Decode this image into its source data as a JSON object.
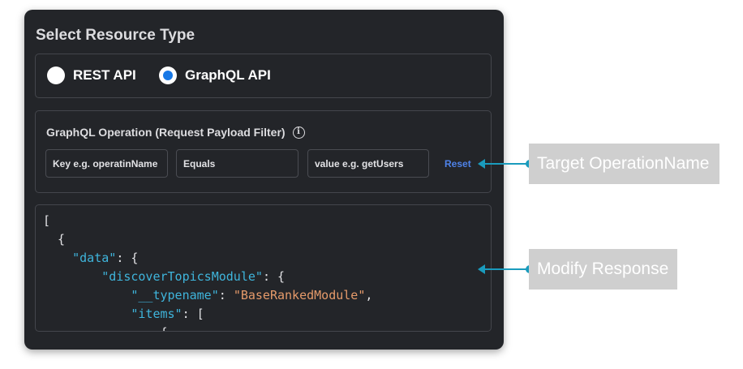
{
  "panel": {
    "title": "Select Resource Type",
    "resource_types": [
      {
        "label": "REST API",
        "selected": false
      },
      {
        "label": "GraphQL API",
        "selected": true
      }
    ],
    "filter": {
      "title": "GraphQL Operation (Request Payload Filter)",
      "key_placeholder": "Key e.g. operatinName",
      "operator_value": "Equals",
      "value_placeholder": "value e.g. getUsers",
      "reset_label": "Reset"
    },
    "code_lines": [
      "[",
      "  {",
      "    \"data\": {",
      "        \"discoverTopicsModule\": {",
      "            \"__typename\": \"BaseRankedModule\",",
      "            \"items\": [",
      "                {"
    ]
  },
  "annotations": {
    "target_operation": "Target OperationName",
    "modify_response": "Modify Response"
  },
  "colors": {
    "panel_bg": "#232529",
    "accent": "#1778e6",
    "json_key": "#3fb5dc",
    "json_string": "#e59a6a",
    "connector": "#1a9bbd",
    "callout_bg": "#cfcfcf"
  }
}
